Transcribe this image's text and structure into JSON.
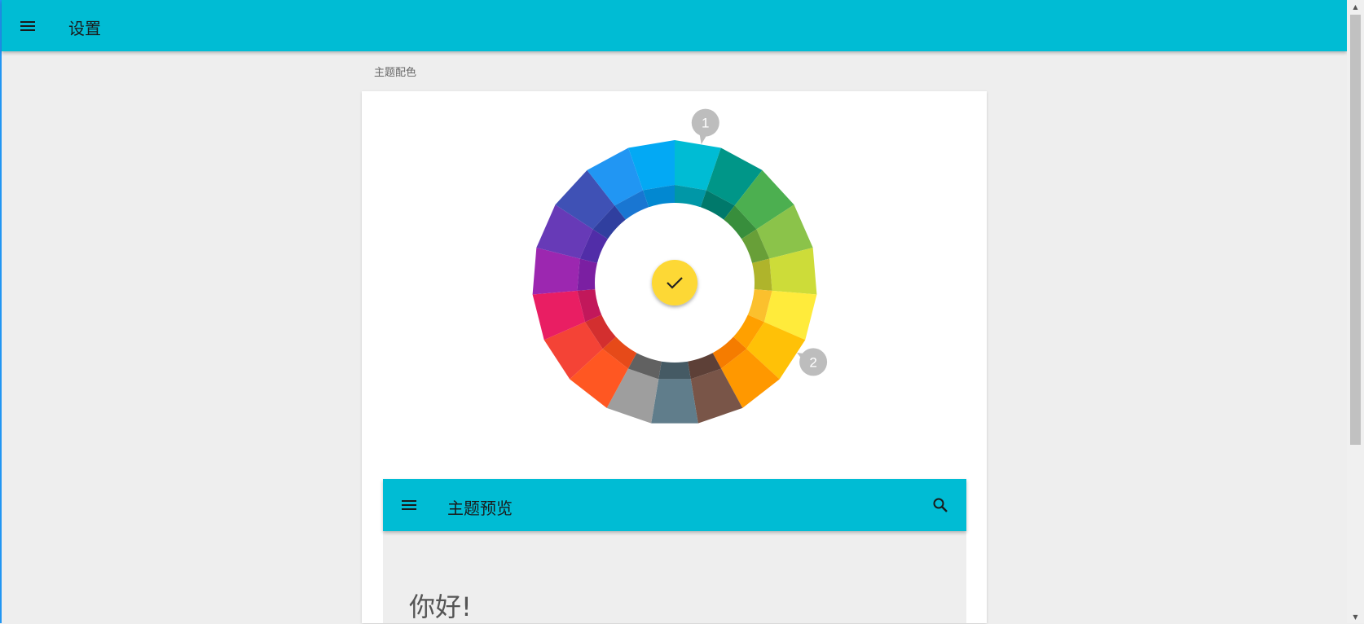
{
  "appbar": {
    "title": "设置",
    "menu_icon": "menu-icon",
    "color": "#00bcd4"
  },
  "section": {
    "label": "主题配色"
  },
  "color_wheel": {
    "colors": [
      "#00BCD4",
      "#009688",
      "#4CAF50",
      "#8BC34A",
      "#CDDC39",
      "#FFEB3B",
      "#FFC107",
      "#FF9800",
      "#795548",
      "#607D8B",
      "#9E9E9E",
      "#FF5722",
      "#F44336",
      "#E91E63",
      "#9C27B0",
      "#673AB7",
      "#3F51B5",
      "#2196F3",
      "#03A9F4"
    ],
    "inner_colors": [
      "#0097A7",
      "#00796B",
      "#388E3C",
      "#689F38",
      "#AFB42B",
      "#FBC02D",
      "#FFA000",
      "#F57C00",
      "#5D4037",
      "#455A64",
      "#616161",
      "#E64A19",
      "#D32F2F",
      "#C2185B",
      "#7B1FA2",
      "#512DA8",
      "#303F9F",
      "#1976D2",
      "#0288D1"
    ],
    "primary_marker": "1",
    "accent_marker": "2",
    "confirm_icon": "check-icon",
    "confirm_color": "#FDD835"
  },
  "preview": {
    "title": "主题预览",
    "menu_icon": "menu-icon",
    "search_icon": "search-icon",
    "greeting": "你好!"
  }
}
